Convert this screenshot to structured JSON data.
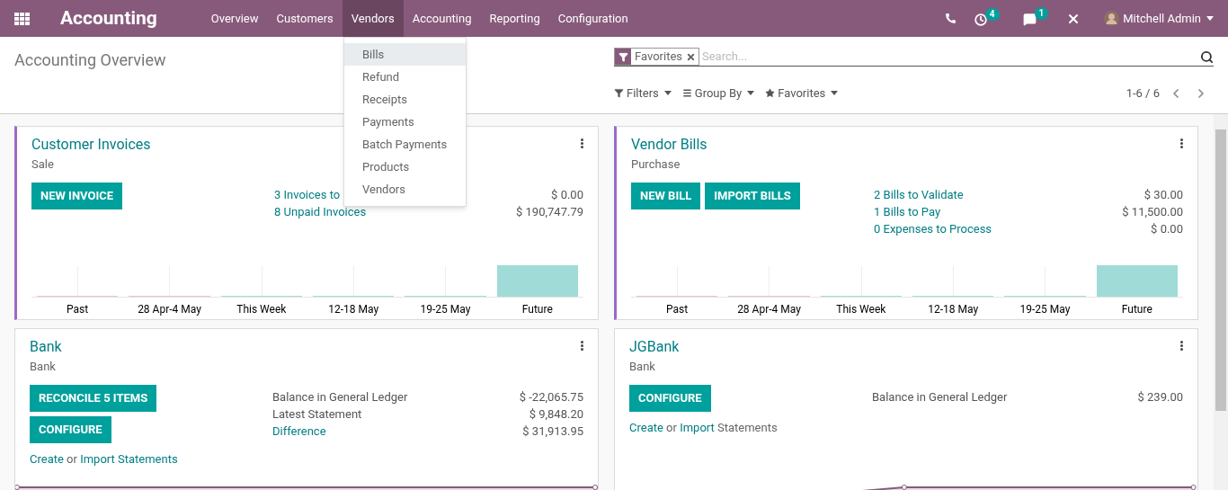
{
  "navbar": {
    "brand": "Accounting",
    "menu": [
      {
        "label": "Overview",
        "selected": false
      },
      {
        "label": "Customers",
        "selected": false
      },
      {
        "label": "Vendors",
        "selected": true
      },
      {
        "label": "Accounting",
        "selected": false
      },
      {
        "label": "Reporting",
        "selected": false
      },
      {
        "label": "Configuration",
        "selected": false
      }
    ],
    "activity_badge": "4",
    "messages_badge": "1",
    "user": "Mitchell Admin"
  },
  "control_panel": {
    "title": "Accounting Overview",
    "facet": "Favorites",
    "placeholder": "Search...",
    "filters": [
      {
        "kind": "filter",
        "label": "Filters"
      },
      {
        "kind": "group",
        "label": "Group By"
      },
      {
        "kind": "favorite",
        "label": "Favorites"
      }
    ],
    "pager": "1-6 / 6"
  },
  "dropdown": {
    "items": [
      {
        "label": "Bills",
        "selected": true
      },
      {
        "label": "Refund",
        "selected": false
      },
      {
        "label": "Receipts",
        "selected": false
      },
      {
        "label": "Payments",
        "selected": false
      },
      {
        "label": "Batch Payments",
        "selected": false
      },
      {
        "label": "Products",
        "selected": false
      },
      {
        "label": "Vendors",
        "selected": false
      }
    ]
  },
  "cards": [
    {
      "title": "Customer Invoices",
      "subtitle": "Sale",
      "color": "#9b6ac6",
      "buttons": [
        "NEW INVOICE"
      ],
      "stats": [
        {
          "label": "3 Invoices to",
          "value": "$ 0.00",
          "link": true
        },
        {
          "label": "8 Unpaid Invoices",
          "value": "$ 190,747.79",
          "link": true
        }
      ],
      "graph": {
        "kind": "bar",
        "labels": [
          "Past",
          "28 Apr-4 May",
          "This Week",
          "12-18 May",
          "19-25 May",
          "Future"
        ]
      }
    },
    {
      "title": "Vendor Bills",
      "subtitle": "Purchase",
      "color": "#9b6ac6",
      "buttons": [
        "NEW BILL",
        "IMPORT BILLS"
      ],
      "stats": [
        {
          "label": "2 Bills to Validate",
          "value": "$ 30.00",
          "link": true
        },
        {
          "label": "1 Bills to Pay",
          "value": "$ 11,500.00",
          "link": true
        },
        {
          "label": "0 Expenses to Process",
          "value": "$ 0.00",
          "link": true
        }
      ],
      "graph": {
        "kind": "bar",
        "labels": [
          "Past",
          "28 Apr-4 May",
          "This Week",
          "12-18 May",
          "19-25 May",
          "Future"
        ]
      }
    },
    {
      "title": "Bank",
      "subtitle": "Bank",
      "buttons": [
        "RECONCILE 5 ITEMS",
        "CONFIGURE"
      ],
      "stats": [
        {
          "label": "Balance in General Ledger",
          "value": "$ -22,065.75",
          "link": false
        },
        {
          "label": "Latest Statement",
          "value": "$ 9,848.20",
          "link": false
        },
        {
          "label": "Difference",
          "value": "$ 31,913.95",
          "link": true
        }
      ],
      "footer": [
        {
          "text": "Create",
          "link": true
        },
        {
          "text": "or",
          "link": false
        },
        {
          "text": "Import Statements",
          "link": true
        }
      ],
      "graph": {
        "kind": "flat_line"
      }
    },
    {
      "title": "JGBank",
      "subtitle": "Bank",
      "buttons": [
        "CONFIGURE"
      ],
      "stats": [
        {
          "label": "Balance in General Ledger",
          "value": "$ 239.00",
          "link": false
        }
      ],
      "footer": [
        {
          "text": "Create",
          "link": true
        },
        {
          "text": "or",
          "link": false
        },
        {
          "text": "Import",
          "link": true
        },
        {
          "text": "Statements",
          "link": false
        }
      ],
      "graph": {
        "kind": "rising_line"
      }
    }
  ]
}
